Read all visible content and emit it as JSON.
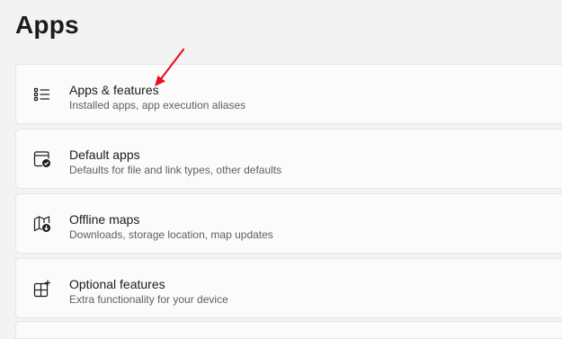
{
  "page": {
    "title": "Apps"
  },
  "items": [
    {
      "title": "Apps & features",
      "subtitle": "Installed apps, app execution aliases",
      "icon": "list-icon"
    },
    {
      "title": "Default apps",
      "subtitle": "Defaults for file and link types, other defaults",
      "icon": "default-apps-icon"
    },
    {
      "title": "Offline maps",
      "subtitle": "Downloads, storage location, map updates",
      "icon": "map-download-icon"
    },
    {
      "title": "Optional features",
      "subtitle": "Extra functionality for your device",
      "icon": "add-features-icon"
    }
  ],
  "annotation": {
    "type": "arrow",
    "color": "#e81123",
    "target": "Apps & features"
  }
}
